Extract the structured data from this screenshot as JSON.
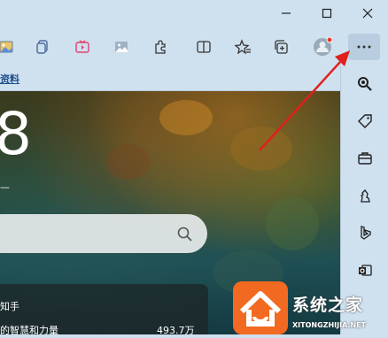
{
  "favorites": {
    "link": "资料"
  },
  "content": {
    "clock_digit": "8",
    "date_fragment": "—",
    "news": {
      "title": "知手",
      "headline": "的智慧和力量",
      "count": "493.7万"
    }
  },
  "watermark": {
    "brand": "系统之家",
    "url": "XITONGZHIJIA.NET"
  },
  "colors": {
    "chrome": "#cfe0ef",
    "arrow": "#e0201b",
    "profile_dot": "#e53935",
    "watermark": "#f26a21"
  },
  "icons": {
    "toolbar": [
      "image-icon",
      "copy-icon",
      "video-collection-icon",
      "picture-icon",
      "extensions-icon",
      "split-screen-icon",
      "favorites-icon",
      "collections-icon",
      "profile-icon",
      "more-options-icon"
    ],
    "sidebar": [
      "search-icon",
      "tag-icon",
      "briefcase-icon",
      "chess-icon",
      "bing-icon",
      "outlook-icon"
    ]
  }
}
